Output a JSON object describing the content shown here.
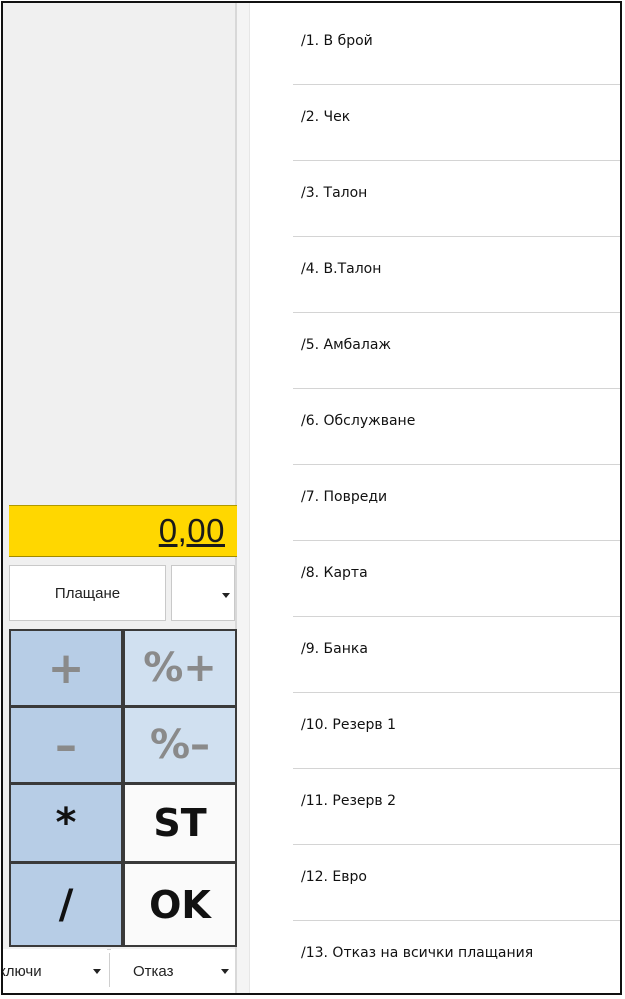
{
  "total": {
    "value": "0,00"
  },
  "payment": {
    "button_label": "Плащане",
    "selected_value": ""
  },
  "keypad": {
    "keys": [
      {
        "label": "+"
      },
      {
        "label": "%+"
      },
      {
        "label": "–"
      },
      {
        "label": "%–"
      },
      {
        "label": "*"
      },
      {
        "label": "ST"
      },
      {
        "label": "/"
      },
      {
        "label": "OK"
      }
    ]
  },
  "bottom": {
    "left_label": "ключи",
    "cancel_label": "Отказ"
  },
  "menu": {
    "items": [
      {
        "label": "/1. В брой"
      },
      {
        "label": "/2. Чек"
      },
      {
        "label": "/3. Талон"
      },
      {
        "label": "/4. В.Талон"
      },
      {
        "label": "/5. Амбалаж"
      },
      {
        "label": "/6. Обслужване"
      },
      {
        "label": "/7. Повреди"
      },
      {
        "label": "/8. Карта"
      },
      {
        "label": "/9. Банка"
      },
      {
        "label": "/10. Резерв 1"
      },
      {
        "label": "/11. Резерв 2"
      },
      {
        "label": "/12. Евро"
      },
      {
        "label": "/13. Отказ на всички плащания"
      }
    ]
  },
  "colors": {
    "total_bg": "#ffd700",
    "key_blue": "#b7cde6",
    "key_lightblue": "#d0e0f0",
    "separator": "#d4d4d4"
  }
}
